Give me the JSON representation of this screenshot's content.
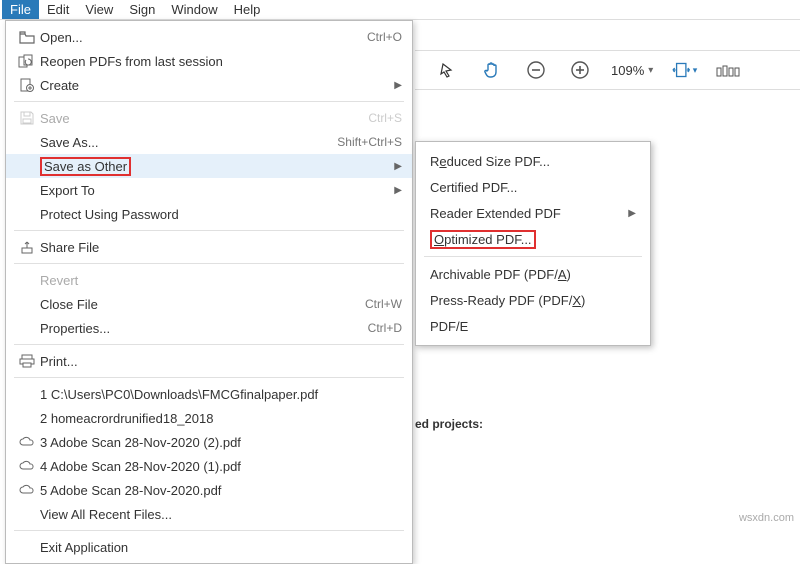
{
  "menubar": {
    "items": [
      "File",
      "Edit",
      "View",
      "Sign",
      "Window",
      "Help"
    ]
  },
  "toolbar": {
    "zoom_value": "109%"
  },
  "file_menu": {
    "open": "Open...",
    "open_sc": "Ctrl+O",
    "reopen": "Reopen PDFs from last session",
    "create": "Create",
    "save": "Save",
    "save_sc": "Ctrl+S",
    "save_as": "Save As...",
    "save_as_sc": "Shift+Ctrl+S",
    "save_other": "Save as Other",
    "export": "Export To",
    "protect": "Protect Using Password",
    "share": "Share File",
    "revert": "Revert",
    "close": "Close File",
    "close_sc": "Ctrl+W",
    "props": "Properties...",
    "props_sc": "Ctrl+D",
    "print": "Print...",
    "recent1": "1 C:\\Users\\PC0\\Downloads\\FMCGfinalpaper.pdf",
    "recent2": "2 homeacrordrunified18_2018",
    "recent3": "3 Adobe Scan 28-Nov-2020 (2).pdf",
    "recent4": "4 Adobe Scan 28-Nov-2020 (1).pdf",
    "recent5": "5 Adobe Scan 28-Nov-2020.pdf",
    "view_all": "View All Recent Files...",
    "exit": "Exit Application"
  },
  "submenu": {
    "reduced_pre": "R",
    "reduced_u": "e",
    "reduced_post": "duced Size PDF...",
    "certified": "Certified PDF...",
    "reader": "Reader Extended PDF",
    "optimized_u": "O",
    "optimized_post": "ptimized PDF...",
    "arch_pre": "Archivable PDF (PDF/",
    "arch_u": "A",
    "arch_post": ")",
    "press_pre": "Press-Ready PDF (PDF/",
    "press_u": "X",
    "press_post": ")",
    "pdfe": "PDF/E"
  },
  "bg": {
    "text": "ed projects:"
  },
  "watermark": "wsxdn.com"
}
